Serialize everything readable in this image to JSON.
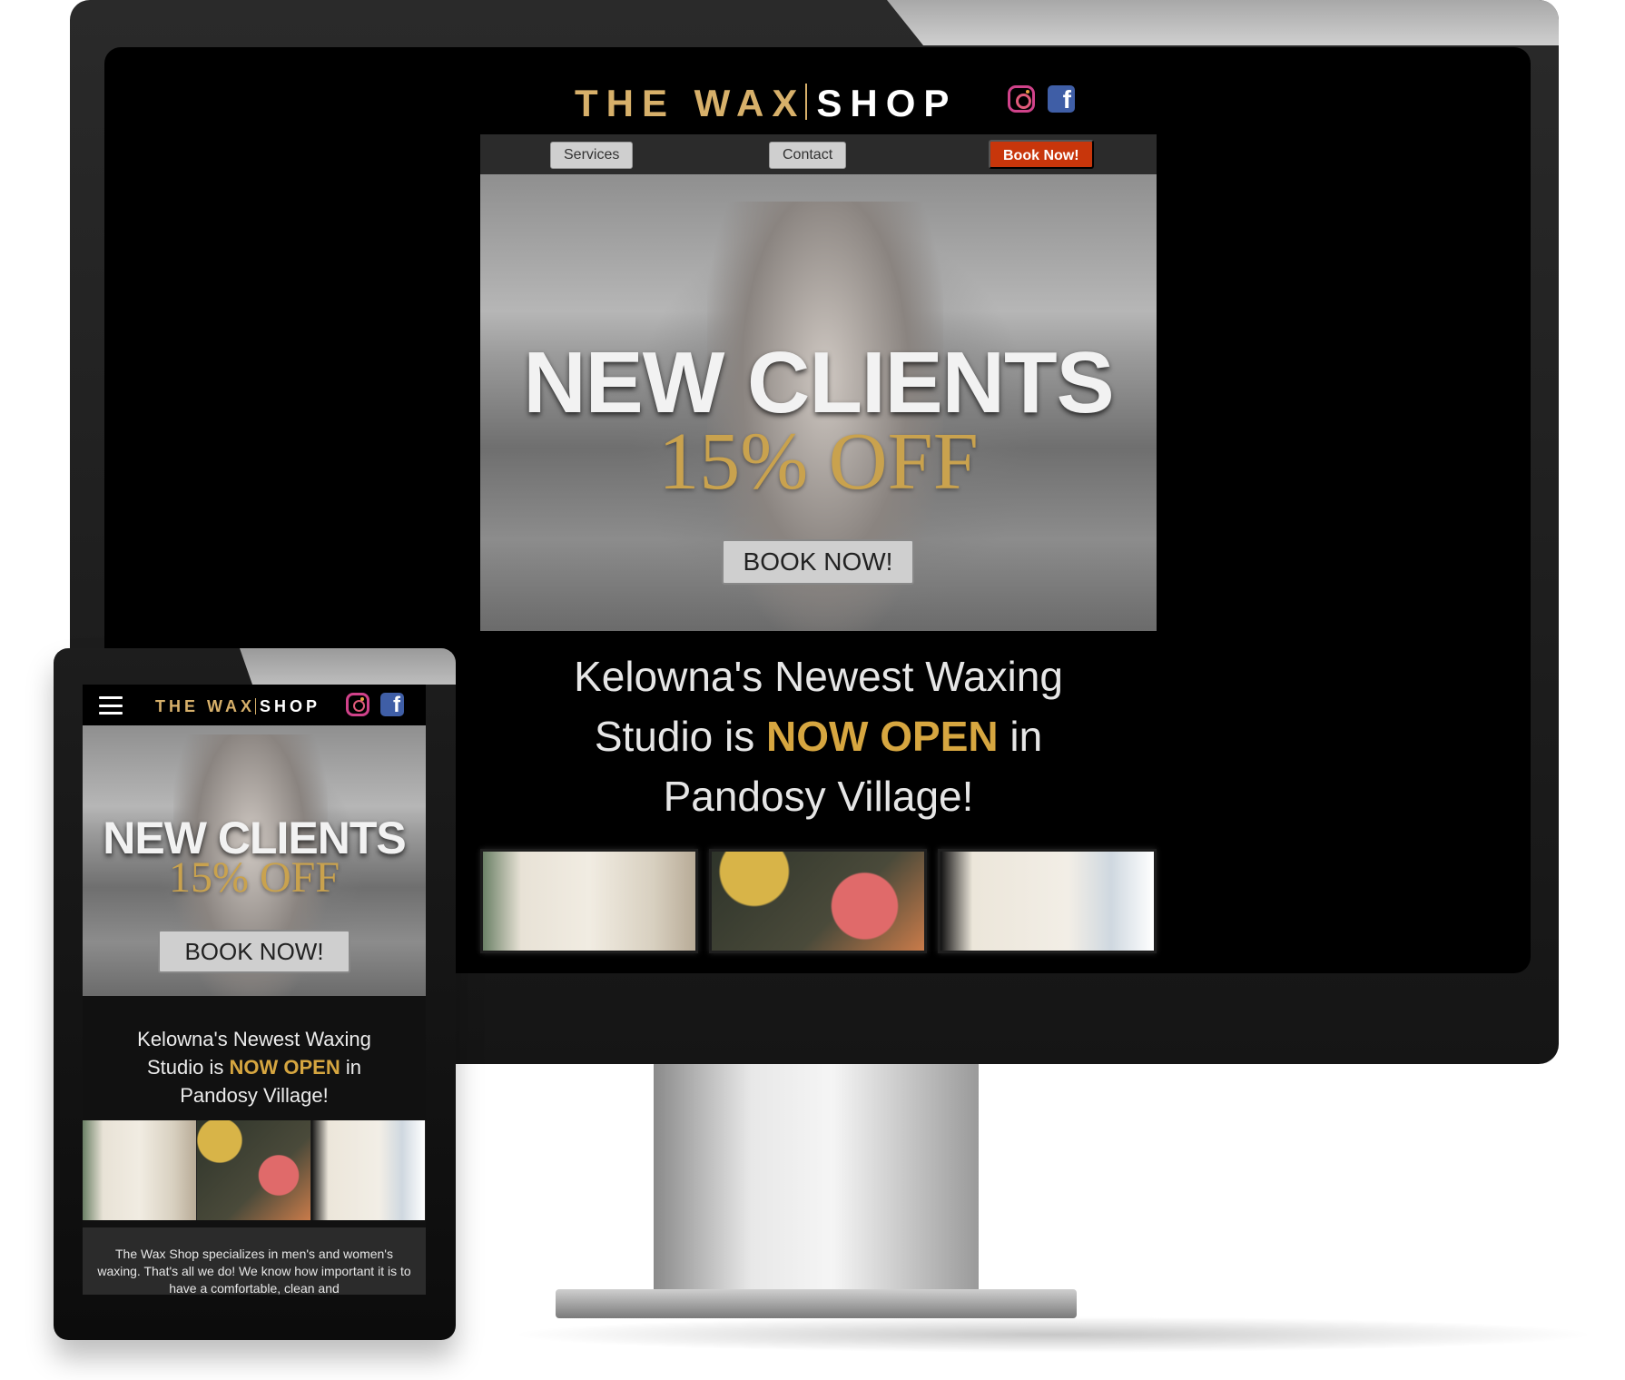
{
  "brand": {
    "logo_part1": "THE WAX",
    "logo_part2": "SHOP",
    "gold": "#d7b06a",
    "accent_red": "#c8360b"
  },
  "social": {
    "instagram": "instagram-icon",
    "facebook": "facebook-icon",
    "facebook_glyph": "f"
  },
  "desktop": {
    "nav": {
      "services_label": "Services",
      "contact_label": "Contact",
      "book_label": "Book Now!"
    },
    "hero": {
      "title": "NEW CLIENTS",
      "subtitle": "15% OFF",
      "button": "BOOK NOW!"
    },
    "headline": {
      "line1": "Kelowna's Newest Waxing",
      "line2_prefix": "Studio is ",
      "highlight": "NOW OPEN",
      "line2_suffix": " in",
      "line3": "Pandosy Village!"
    },
    "gallery": [
      "studio-interior-image",
      "gift-products-image",
      "studio-room-image"
    ]
  },
  "mobile": {
    "hero": {
      "title": "NEW CLIENTS",
      "subtitle": "15% OFF",
      "button": "BOOK NOW!"
    },
    "headline": {
      "line1": "Kelowna's Newest Waxing",
      "line2_prefix": "Studio is ",
      "highlight": "NOW OPEN",
      "line2_suffix": " in",
      "line3": "Pandosy Village!"
    },
    "paragraph": "The Wax Shop specializes in men's and women's waxing. That's all we do! We know how important it is to have a comfortable, clean and"
  }
}
